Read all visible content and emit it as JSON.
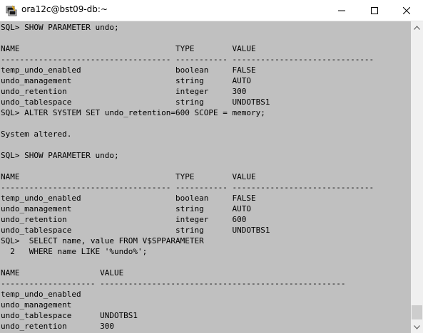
{
  "window": {
    "title": "ora12c@bst09-db:~"
  },
  "terminal": {
    "lines": [
      "SQL> SHOW PARAMETER undo;",
      "",
      "NAME                                 TYPE        VALUE",
      "------------------------------------ ----------- ------------------------------",
      "temp_undo_enabled                    boolean     FALSE",
      "undo_management                      string      AUTO",
      "undo_retention                       integer     300",
      "undo_tablespace                      string      UNDOTBS1",
      "SQL> ALTER SYSTEM SET undo_retention=600 SCOPE = memory;",
      "",
      "System altered.",
      "",
      "SQL> SHOW PARAMETER undo;",
      "",
      "NAME                                 TYPE        VALUE",
      "------------------------------------ ----------- ------------------------------",
      "temp_undo_enabled                    boolean     FALSE",
      "undo_management                      string      AUTO",
      "undo_retention                       integer     600",
      "undo_tablespace                      string      UNDOTBS1",
      "SQL>  SELECT name, value FROM V$SPPARAMETER",
      "  2   WHERE name LIKE '%undo%';",
      "",
      "NAME                 VALUE",
      "-------------------- ----------------------------------------------------",
      "temp_undo_enabled",
      "undo_management",
      "undo_tablespace      UNDOTBS1",
      "undo_retention       300"
    ]
  },
  "icons": {
    "app": "putty-terminal-icon",
    "minimize": "minimize-icon",
    "maximize": "maximize-icon",
    "close": "close-icon",
    "scroll_up": "chevron-up-icon",
    "scroll_down": "chevron-down-icon"
  },
  "colors": {
    "terminal_background": "#c0c0c0",
    "terminal_text": "#000000",
    "titlebar": "#ffffff",
    "scrollbar_track": "#f0f0f0",
    "scrollbar_thumb": "#cdcdcd"
  }
}
